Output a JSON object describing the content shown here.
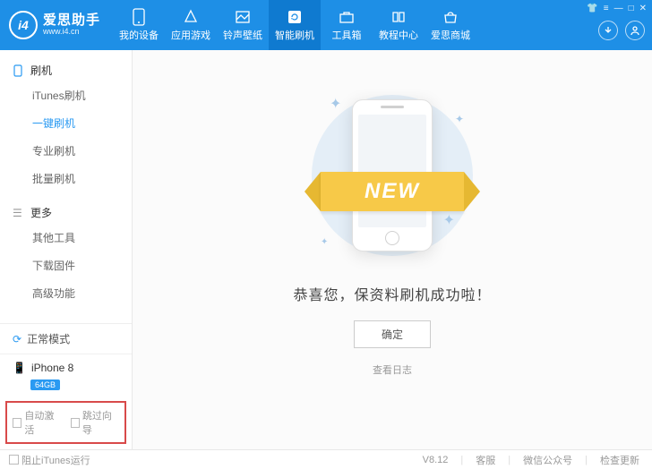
{
  "app": {
    "name": "爱思助手",
    "url": "www.i4.cn",
    "logo_mark": "i4"
  },
  "nav": {
    "items": [
      {
        "label": "我的设备"
      },
      {
        "label": "应用游戏"
      },
      {
        "label": "铃声壁纸"
      },
      {
        "label": "智能刷机",
        "active": true
      },
      {
        "label": "工具箱"
      },
      {
        "label": "教程中心"
      },
      {
        "label": "爱思商城"
      }
    ]
  },
  "sidebar": {
    "section1": {
      "title": "刷机",
      "items": [
        {
          "label": "iTunes刷机"
        },
        {
          "label": "一键刷机",
          "active": true
        },
        {
          "label": "专业刷机"
        },
        {
          "label": "批量刷机"
        }
      ]
    },
    "section2": {
      "title": "更多",
      "items": [
        {
          "label": "其他工具"
        },
        {
          "label": "下载固件"
        },
        {
          "label": "高级功能"
        }
      ]
    },
    "mode": "正常模式",
    "device": {
      "name": "iPhone 8",
      "storage": "64GB"
    },
    "checks": {
      "auto_activate": "自动激活",
      "skip_guide": "跳过向导"
    }
  },
  "main": {
    "ribbon": "NEW",
    "message": "恭喜您，保资料刷机成功啦！",
    "ok": "确定",
    "log": "查看日志"
  },
  "footer": {
    "block_itunes": "阻止iTunes运行",
    "version": "V8.12",
    "support": "客服",
    "wechat": "微信公众号",
    "update": "检查更新"
  }
}
